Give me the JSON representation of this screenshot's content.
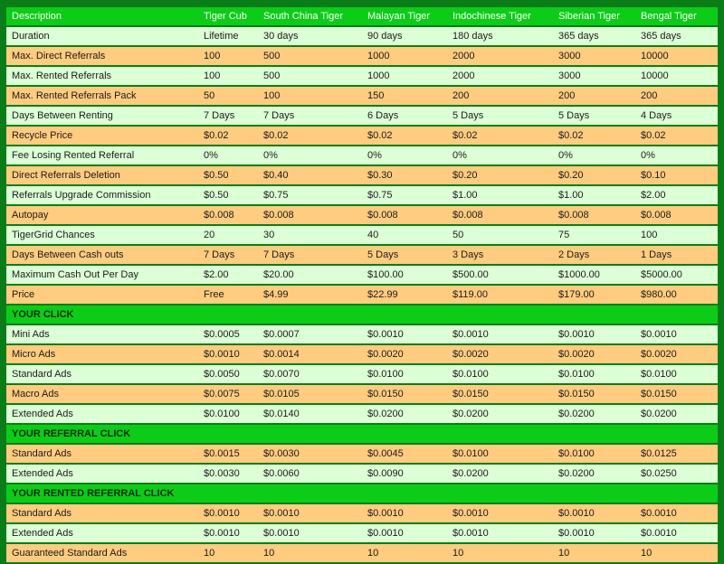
{
  "header": [
    "Description",
    "Tiger Cub",
    "South China Tiger",
    "Malayan Tiger",
    "Indochinese Tiger",
    "Siberian Tiger",
    "Bengal Tiger"
  ],
  "rows": [
    {
      "type": "light",
      "cells": [
        "Duration",
        "Lifetime",
        "30 days",
        "90 days",
        "180 days",
        "365 days",
        "365 days"
      ]
    },
    {
      "type": "orange",
      "cells": [
        "Max. Direct Referrals",
        "100",
        "500",
        "1000",
        "2000",
        "3000",
        "10000"
      ]
    },
    {
      "type": "light",
      "cells": [
        "Max. Rented Referrals",
        "100",
        "500",
        "1000",
        "2000",
        "3000",
        "10000"
      ]
    },
    {
      "type": "orange",
      "cells": [
        "Max. Rented Referrals Pack",
        "50",
        "100",
        "150",
        "200",
        "200",
        "200"
      ]
    },
    {
      "type": "light",
      "cells": [
        "Days Between Renting",
        "7 Days",
        "7 Days",
        "6 Days",
        "5 Days",
        "5 Days",
        "4 Days"
      ]
    },
    {
      "type": "orange",
      "cells": [
        "Recycle Price",
        "$0.02",
        "$0.02",
        "$0.02",
        "$0.02",
        "$0.02",
        "$0.02"
      ]
    },
    {
      "type": "light",
      "cells": [
        "Fee Losing Rented Referral",
        "0%",
        "0%",
        "0%",
        "0%",
        "0%",
        "0%"
      ]
    },
    {
      "type": "orange",
      "cells": [
        "Direct Referrals Deletion",
        "$0.50",
        "$0.40",
        "$0.30",
        "$0.20",
        "$0.20",
        "$0.10"
      ]
    },
    {
      "type": "light",
      "cells": [
        "Referrals Upgrade Commission",
        "$0.50",
        "$0.75",
        "$0.75",
        "$1.00",
        "$1.00",
        "$2.00"
      ]
    },
    {
      "type": "orange",
      "cells": [
        "Autopay",
        "$0.008",
        "$0.008",
        "$0.008",
        "$0.008",
        "$0.008",
        "$0.008"
      ]
    },
    {
      "type": "light",
      "cells": [
        "TigerGrid Chances",
        "20",
        "30",
        "40",
        "50",
        "75",
        "100"
      ]
    },
    {
      "type": "orange",
      "cells": [
        "Days Between Cash outs",
        "7 Days",
        "7 Days",
        "5 Days",
        "3 Days",
        "2 Days",
        "1 Days"
      ]
    },
    {
      "type": "light",
      "cells": [
        "Maximum Cash Out Per Day",
        "$2.00",
        "$20.00",
        "$100.00",
        "$500.00",
        "$1000.00",
        "$5000.00"
      ]
    },
    {
      "type": "orange",
      "cells": [
        "Price",
        "Free",
        "$4.99",
        "$22.99",
        "$119.00",
        "$179.00",
        "$980.00"
      ]
    },
    {
      "type": "section",
      "cells": [
        "YOUR CLICK"
      ]
    },
    {
      "type": "light",
      "cells": [
        "Mini Ads",
        "$0.0005",
        "$0.0007",
        "$0.0010",
        "$0.0010",
        "$0.0010",
        "$0.0010"
      ]
    },
    {
      "type": "orange",
      "cells": [
        "Micro Ads",
        "$0.0010",
        "$0.0014",
        "$0.0020",
        "$0.0020",
        "$0.0020",
        "$0.0020"
      ]
    },
    {
      "type": "light",
      "cells": [
        "Standard Ads",
        "$0.0050",
        "$0.0070",
        "$0.0100",
        "$0.0100",
        "$0.0100",
        "$0.0100"
      ]
    },
    {
      "type": "orange",
      "cells": [
        "Macro Ads",
        "$0.0075",
        "$0.0105",
        "$0.0150",
        "$0.0150",
        "$0.0150",
        "$0.0150"
      ]
    },
    {
      "type": "light",
      "cells": [
        "Extended Ads",
        "$0.0100",
        "$0.0140",
        "$0.0200",
        "$0.0200",
        "$0.0200",
        "$0.0200"
      ]
    },
    {
      "type": "section",
      "cells": [
        "YOUR REFERRAL CLICK"
      ]
    },
    {
      "type": "orange",
      "cells": [
        "Standard Ads",
        "$0.0015",
        "$0.0030",
        "$0.0045",
        "$0.0100",
        "$0.0100",
        "$0.0125"
      ]
    },
    {
      "type": "light",
      "cells": [
        "Extended Ads",
        "$0.0030",
        "$0.0060",
        "$0.0090",
        "$0.0200",
        "$0.0200",
        "$0.0250"
      ]
    },
    {
      "type": "section",
      "cells": [
        "YOUR RENTED REFERRAL CLICK"
      ]
    },
    {
      "type": "orange",
      "cells": [
        "Standard Ads",
        "$0.0010",
        "$0.0010",
        "$0.0010",
        "$0.0010",
        "$0.0010",
        "$0.0010"
      ]
    },
    {
      "type": "light",
      "cells": [
        "Extended Ads",
        "$0.0010",
        "$0.0010",
        "$0.0010",
        "$0.0010",
        "$0.0010",
        "$0.0010"
      ]
    },
    {
      "type": "orange",
      "cells": [
        "Guaranteed Standard Ads",
        "10",
        "10",
        "10",
        "10",
        "10",
        "10"
      ]
    }
  ],
  "colors": {
    "page_bg": "#0a7d18",
    "header_bg": "#0ccc18",
    "row_light": "#dcffd6",
    "row_orange": "#ffcc80"
  }
}
